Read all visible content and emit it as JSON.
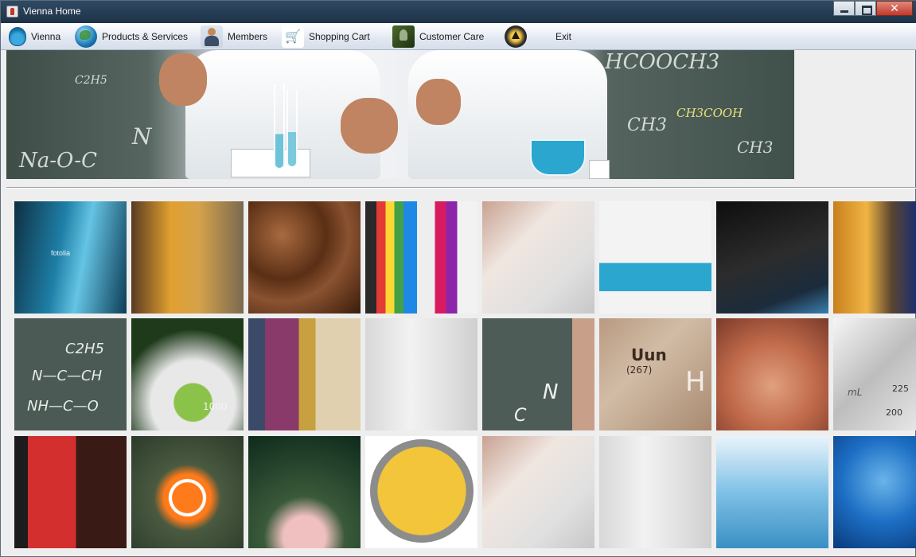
{
  "window": {
    "title": "Vienna Home",
    "close_glyph": "✕"
  },
  "menu": [
    {
      "label": "Vienna",
      "icon": "flask-icon"
    },
    {
      "label": "Products & Services",
      "icon": "globe-icon"
    },
    {
      "label": "Members",
      "icon": "person-icon"
    },
    {
      "label": "Shopping Cart",
      "icon": "cart-icon"
    },
    {
      "label": "Customer Care",
      "icon": "customer-care-icon"
    },
    {
      "label": "Exit",
      "icon": "exit-icon"
    }
  ],
  "banner": {
    "chem_labels": [
      "HCOOCH3",
      "CH3",
      "CH3COOH",
      "CH3",
      "N",
      "Na-O-C",
      "C2H5"
    ]
  },
  "gallery": {
    "watermark": "fotolia",
    "tiles": [
      {
        "subject": "blue test tubes"
      },
      {
        "subject": "orange coat lab clamp"
      },
      {
        "subject": "coffee beans"
      },
      {
        "subject": "colored tubes rack"
      },
      {
        "subject": "lab coat blur"
      },
      {
        "subject": "blue flask pouring"
      },
      {
        "subject": "dark beaker blue"
      },
      {
        "subject": "orange lab tubes"
      },
      {
        "subject": "chalkboard formula",
        "text": [
          "C2H5",
          "N—C—CH",
          "NH—C—O"
        ]
      },
      {
        "subject": "green flask hand",
        "text": [
          "1000"
        ]
      },
      {
        "subject": "scientist goggles"
      },
      {
        "subject": "beaker pipette"
      },
      {
        "subject": "chalkboard coat",
        "text": [
          "N",
          "C"
        ]
      },
      {
        "subject": "periodic table",
        "text": [
          "Uun",
          "(267)",
          "H"
        ]
      },
      {
        "subject": "pills in hand"
      },
      {
        "subject": "graduated cylinder",
        "text": [
          "mL",
          "225",
          "200"
        ]
      },
      {
        "subject": "red fabric"
      },
      {
        "subject": "clownfish"
      },
      {
        "subject": "dark green blur"
      },
      {
        "subject": "recycle medallion"
      },
      {
        "subject": "lab coat blur 2"
      },
      {
        "subject": "beaker pipette 2"
      },
      {
        "subject": "distillation equipment"
      },
      {
        "subject": "blue abstract"
      }
    ]
  },
  "colors": {
    "menubar": "#e2e8f2",
    "titlebar": "#1d3246",
    "window_bg": "#eeeeee"
  }
}
